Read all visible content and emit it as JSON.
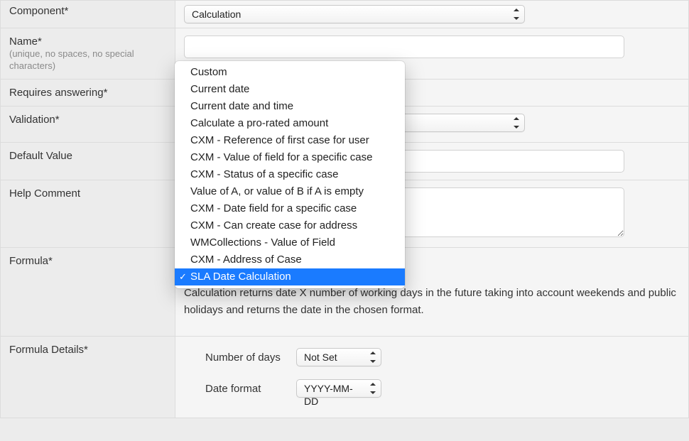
{
  "labels": {
    "component": "Component*",
    "name": "Name*",
    "name_hint": "(unique, no spaces, no special characters)",
    "requires_answering": "Requires answering*",
    "validation": "Validation*",
    "default_value": "Default Value",
    "help_comment": "Help Comment",
    "formula": "Formula*",
    "formula_details": "Formula Details*"
  },
  "values": {
    "component": "Calculation",
    "name": "",
    "requires_answering": "",
    "validation": "",
    "default_value": "",
    "help_comment": "",
    "formula_selected": "SLA Date Calculation",
    "formula_description": "Calculation returns date X number of working days in the future taking into account weekends and public holidays and returns the date in the chosen format."
  },
  "formula_details": {
    "number_of_days_label": "Number of days",
    "number_of_days_value": "Not Set",
    "date_format_label": "Date format",
    "date_format_value": "YYYY-MM-DD"
  },
  "formula_options": [
    {
      "label": "Custom",
      "selected": false
    },
    {
      "label": "Current date",
      "selected": false
    },
    {
      "label": "Current date and time",
      "selected": false
    },
    {
      "label": "Calculate a pro-rated amount",
      "selected": false
    },
    {
      "label": "CXM - Reference of first case for user",
      "selected": false
    },
    {
      "label": "CXM - Value of field for a specific case",
      "selected": false
    },
    {
      "label": "CXM - Status of a specific case",
      "selected": false
    },
    {
      "label": "Value of A, or value of B if A is empty",
      "selected": false
    },
    {
      "label": "CXM - Date field for a specific case",
      "selected": false
    },
    {
      "label": "CXM - Can create case for address",
      "selected": false
    },
    {
      "label": "WMCollections - Value of Field",
      "selected": false
    },
    {
      "label": "CXM - Address of Case",
      "selected": false
    },
    {
      "label": "SLA Date Calculation",
      "selected": true
    }
  ]
}
